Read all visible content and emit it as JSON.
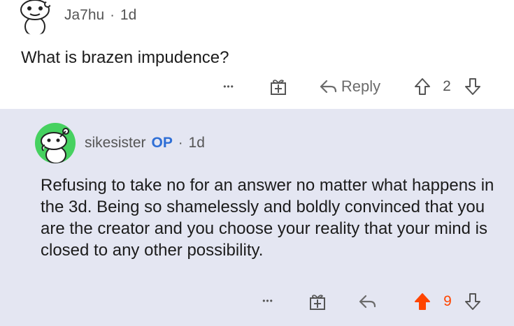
{
  "top_comment": {
    "username": "Ja7hu",
    "age": "1d",
    "body": "What is brazen impudence?",
    "actions": {
      "more_label": "•••",
      "reply_label": "Reply",
      "score": "2"
    }
  },
  "reply_comment": {
    "username": "sikesister",
    "op_badge": "OP",
    "age": "1d",
    "body": "Refusing to take no for an answer no matter what happens in the 3d. Being so shamelessly and boldly convinced that you are the creator and you choose your reality that your mind is closed to any other possibility.",
    "actions": {
      "more_label": "•••",
      "score": "9"
    }
  },
  "colors": {
    "reply_background": "#e4e6f2",
    "upvote_active": "#ff4500",
    "op_badge": "#2f6fd6",
    "avatar_green": "#46d160"
  },
  "icons": [
    "snoo-avatar-icon",
    "more-options-icon",
    "award-gift-icon",
    "reply-arrow-icon",
    "upvote-arrow-icon",
    "downvote-arrow-icon"
  ]
}
